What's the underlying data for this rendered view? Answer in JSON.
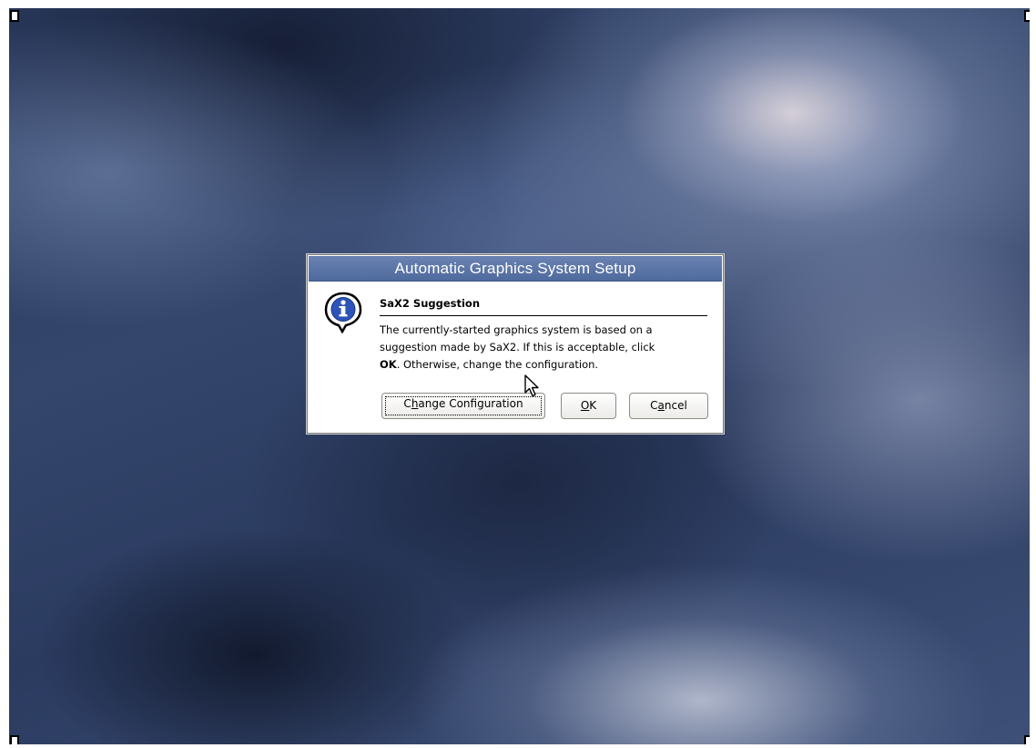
{
  "dialog": {
    "title": "Automatic Graphics System Setup",
    "heading": "SaX2 Suggestion",
    "message": {
      "line1": "The currently-started graphics system is based on a",
      "line2": "suggestion made by SaX2. If this is acceptable, click",
      "bold": "OK",
      "line3_rest": ". Otherwise, change the configuration."
    },
    "icon": "info-speech-bubble-icon",
    "buttons": {
      "change": {
        "pre": "C",
        "mnemonic": "h",
        "post": "ange Configuration"
      },
      "ok": {
        "pre": "",
        "mnemonic": "O",
        "post": "K"
      },
      "cancel": {
        "pre": "C",
        "mnemonic": "a",
        "post": "ncel"
      }
    }
  },
  "colors": {
    "titlebar": "#5a73a6",
    "desktop": "#2f4168"
  }
}
